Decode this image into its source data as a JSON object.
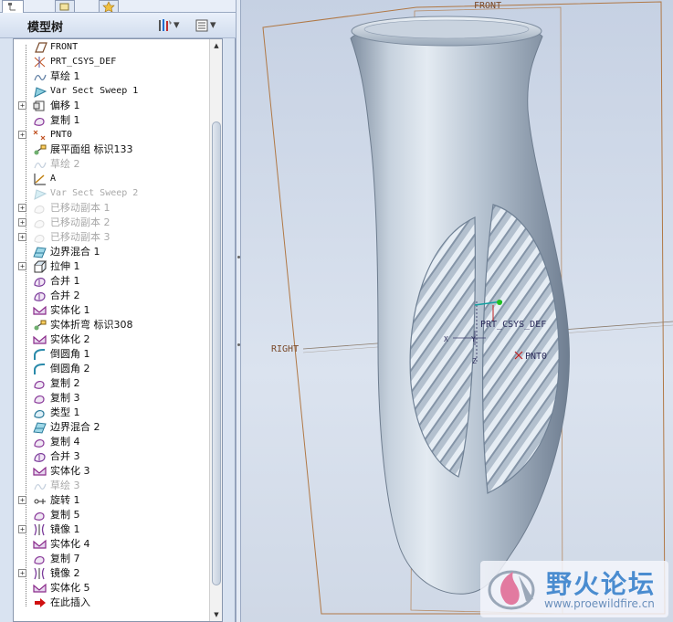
{
  "panel": {
    "title": "模型树",
    "settings_icon": "tree-settings-icon",
    "columns_icon": "tree-columns-icon",
    "dropdown": "▾"
  },
  "tabs": [
    "model-tree-tab",
    "layer-tab",
    "favorites-tab"
  ],
  "tree_items": [
    {
      "label": "FRONT",
      "icon": "datum-plane-icon",
      "expand": false,
      "dim": false,
      "mono": true
    },
    {
      "label": "PRT_CSYS_DEF",
      "icon": "csys-icon",
      "expand": false,
      "dim": false,
      "mono": true
    },
    {
      "label": "草绘 1",
      "icon": "sketch-icon",
      "expand": false,
      "dim": false,
      "mono": false
    },
    {
      "label": "Var Sect Sweep 1",
      "icon": "var-sweep-icon",
      "expand": false,
      "dim": false,
      "mono": true
    },
    {
      "label": "偏移 1",
      "icon": "offset-icon",
      "expand": true,
      "dim": false,
      "mono": false
    },
    {
      "label": "复制 1",
      "icon": "copy-icon",
      "expand": false,
      "dim": false,
      "mono": false
    },
    {
      "label": "PNT0",
      "icon": "datum-point-icon",
      "expand": true,
      "dim": false,
      "mono": true
    },
    {
      "label": "展平面组 标识133",
      "icon": "flatten-quilt-icon",
      "expand": false,
      "dim": false,
      "mono": false
    },
    {
      "label": "草绘 2",
      "icon": "sketch-icon",
      "expand": false,
      "dim": true,
      "mono": false
    },
    {
      "label": "A",
      "icon": "datum-axis-icon",
      "expand": false,
      "dim": false,
      "mono": true
    },
    {
      "label": "Var Sect Sweep 2",
      "icon": "var-sweep-icon",
      "expand": false,
      "dim": true,
      "mono": true
    },
    {
      "label": "已移动副本 1",
      "icon": "moved-copy-icon",
      "expand": true,
      "dim": true,
      "mono": false
    },
    {
      "label": "已移动副本 2",
      "icon": "moved-copy-icon",
      "expand": true,
      "dim": true,
      "mono": false
    },
    {
      "label": "已移动副本 3",
      "icon": "moved-copy-icon",
      "expand": true,
      "dim": true,
      "mono": false
    },
    {
      "label": "边界混合 1",
      "icon": "boundary-blend-icon",
      "expand": false,
      "dim": false,
      "mono": false
    },
    {
      "label": "拉伸 1",
      "icon": "extrude-icon",
      "expand": true,
      "dim": false,
      "mono": false
    },
    {
      "label": "合并 1",
      "icon": "merge-icon",
      "expand": false,
      "dim": false,
      "mono": false
    },
    {
      "label": "合并 2",
      "icon": "merge-icon",
      "expand": false,
      "dim": false,
      "mono": false
    },
    {
      "label": "实体化 1",
      "icon": "solidify-icon",
      "expand": false,
      "dim": false,
      "mono": false
    },
    {
      "label": "实体折弯 标识308",
      "icon": "solid-bend-icon",
      "expand": false,
      "dim": false,
      "mono": false
    },
    {
      "label": "实体化 2",
      "icon": "solidify-icon",
      "expand": false,
      "dim": false,
      "mono": false
    },
    {
      "label": "倒圆角 1",
      "icon": "round-icon",
      "expand": false,
      "dim": false,
      "mono": false
    },
    {
      "label": "倒圆角 2",
      "icon": "round-icon",
      "expand": false,
      "dim": false,
      "mono": false
    },
    {
      "label": "复制 2",
      "icon": "copy-icon",
      "expand": false,
      "dim": false,
      "mono": false
    },
    {
      "label": "复制 3",
      "icon": "copy-icon",
      "expand": false,
      "dim": false,
      "mono": false
    },
    {
      "label": "类型 1",
      "icon": "pattern-icon",
      "expand": false,
      "dim": false,
      "mono": false
    },
    {
      "label": "边界混合 2",
      "icon": "boundary-blend-icon",
      "expand": false,
      "dim": false,
      "mono": false
    },
    {
      "label": "复制 4",
      "icon": "copy-icon",
      "expand": false,
      "dim": false,
      "mono": false
    },
    {
      "label": "合并 3",
      "icon": "merge-icon",
      "expand": false,
      "dim": false,
      "mono": false
    },
    {
      "label": "实体化 3",
      "icon": "solidify-icon",
      "expand": false,
      "dim": false,
      "mono": false
    },
    {
      "label": "草绘 3",
      "icon": "sketch-icon",
      "expand": false,
      "dim": true,
      "mono": false
    },
    {
      "label": "旋转 1",
      "icon": "revolve-icon",
      "expand": true,
      "dim": false,
      "mono": false
    },
    {
      "label": "复制 5",
      "icon": "copy-icon",
      "expand": false,
      "dim": false,
      "mono": false
    },
    {
      "label": "镜像 1",
      "icon": "mirror-icon",
      "expand": true,
      "dim": false,
      "mono": false
    },
    {
      "label": "实体化 4",
      "icon": "solidify-icon",
      "expand": false,
      "dim": false,
      "mono": false
    },
    {
      "label": "复制 7",
      "icon": "copy-icon",
      "expand": false,
      "dim": false,
      "mono": false
    },
    {
      "label": "镜像 2",
      "icon": "mirror-icon",
      "expand": true,
      "dim": false,
      "mono": false
    },
    {
      "label": "实体化 5",
      "icon": "solidify-icon",
      "expand": false,
      "dim": false,
      "mono": false
    },
    {
      "label": "在此插入",
      "icon": "insert-here-arrow-icon",
      "expand": false,
      "dim": false,
      "mono": false
    }
  ],
  "viewport": {
    "labels": {
      "front": "FRONT",
      "right": "RIGHT",
      "csys": "PRT_CSYS_DEF",
      "point": "PNT0",
      "axis_x": "X",
      "axis_y": "Y",
      "axis_z": "Z"
    },
    "colors": {
      "datum_plane": "#b07845",
      "model": "#a9b7c6",
      "background": "#d4dcea"
    }
  },
  "watermark": {
    "title": "野火论坛",
    "url": "www.proewildfire.cn"
  }
}
